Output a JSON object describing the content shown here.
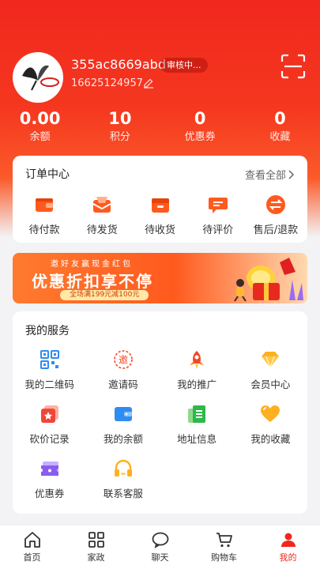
{
  "profile": {
    "username": "355ac8669abd",
    "status_badge": "审核中...",
    "phone": "16625124957"
  },
  "stats": [
    {
      "value": "0.00",
      "label": "余额"
    },
    {
      "value": "10",
      "label": "积分"
    },
    {
      "value": "0",
      "label": "优惠券"
    },
    {
      "value": "0",
      "label": "收藏"
    }
  ],
  "orders": {
    "title": "订单中心",
    "view_all": "查看全部",
    "items": [
      {
        "label": "待付款",
        "icon": "wallet-icon"
      },
      {
        "label": "待发货",
        "icon": "package-icon"
      },
      {
        "label": "待收货",
        "icon": "box-icon"
      },
      {
        "label": "待评价",
        "icon": "comment-icon"
      },
      {
        "label": "售后/退款",
        "icon": "refund-icon"
      }
    ]
  },
  "banner": {
    "top": "邀好友赢现金红包",
    "main": "优惠折扣享不停",
    "sub": "全场满199元减100元"
  },
  "services": {
    "title": "我的服务",
    "items": [
      {
        "label": "我的二维码",
        "icon": "qrcode-icon"
      },
      {
        "label": "邀请码",
        "icon": "invite-icon"
      },
      {
        "label": "我的推广",
        "icon": "rocket-icon"
      },
      {
        "label": "会员中心",
        "icon": "diamond-icon"
      },
      {
        "label": "砍价记录",
        "icon": "bargain-icon"
      },
      {
        "label": "我的余额",
        "icon": "balance-icon"
      },
      {
        "label": "地址信息",
        "icon": "address-icon"
      },
      {
        "label": "我的收藏",
        "icon": "heart-icon"
      },
      {
        "label": "优惠券",
        "icon": "coupon-icon"
      },
      {
        "label": "联系客服",
        "icon": "headset-icon"
      }
    ]
  },
  "tabbar": [
    {
      "label": "首页",
      "icon": "home-icon"
    },
    {
      "label": "家政",
      "icon": "grid-icon"
    },
    {
      "label": "聊天",
      "icon": "chat-icon"
    },
    {
      "label": "购物车",
      "icon": "cart-icon"
    },
    {
      "label": "我的",
      "icon": "user-icon",
      "active": true
    }
  ],
  "colors": {
    "brand": "#f0281e",
    "orange": "#ff6a1a"
  }
}
